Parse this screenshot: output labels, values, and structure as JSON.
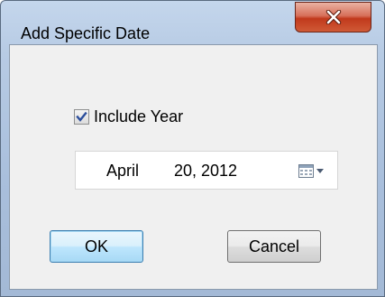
{
  "window": {
    "title": "Add Specific Date",
    "close_symbol": "X"
  },
  "include_year": {
    "label": "Include Year",
    "checked": true
  },
  "date_picker": {
    "month": "April",
    "day_year": "20, 2012",
    "icon": "calendar-dropdown-icon"
  },
  "buttons": {
    "ok_label": "OK",
    "cancel_label": "Cancel"
  },
  "colors": {
    "title_bar": "#b7cbe4",
    "close_button": "#c1391c",
    "dialog_bg": "#f0f0f0",
    "default_button": "#bee6fd",
    "check_mark": "#2b4e9c"
  }
}
